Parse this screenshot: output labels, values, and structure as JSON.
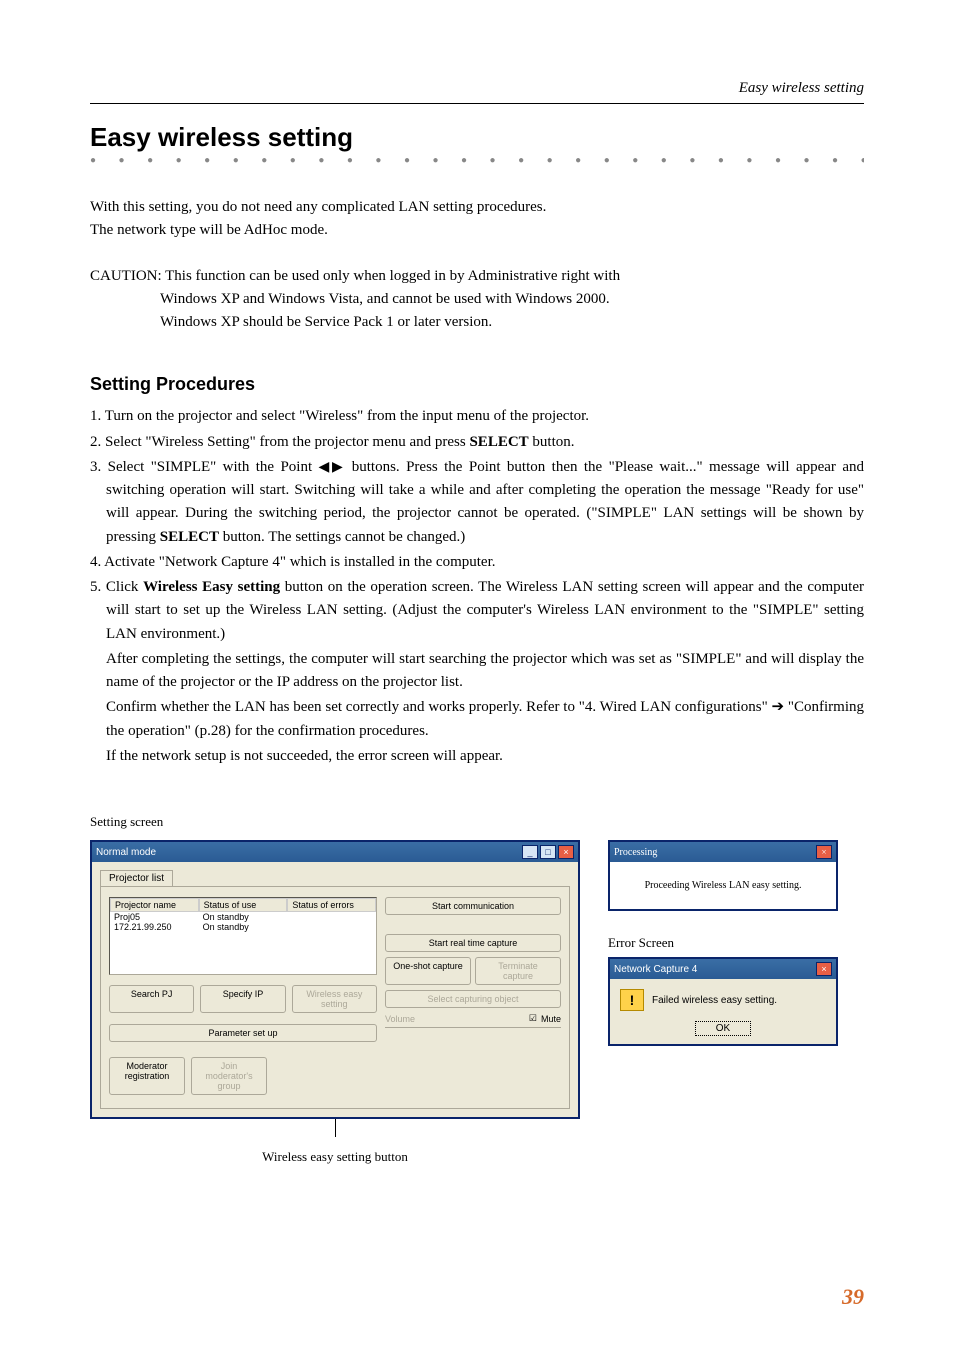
{
  "header": {
    "right_label": "Easy wireless setting"
  },
  "title": "Easy wireless setting",
  "intro": {
    "line1": "With this setting, you do not need any complicated LAN setting procedures.",
    "line2": "The network type will be AdHoc mode."
  },
  "caution": {
    "line1": "CAUTION: This function can be used only when logged in by Administrative right with",
    "line2": "Windows XP and Windows Vista, and cannot be used with Windows 2000.",
    "line3": "Windows XP should be Service Pack 1 or later version."
  },
  "procedures": {
    "heading": "Setting Procedures",
    "s1": "1. Turn on the projector and select \"Wireless\" from the input menu of the projector.",
    "s2_a": "2. Select \"Wireless Setting\" from the projector menu and press ",
    "s2_b": "SELECT",
    "s2_c": " button.",
    "s3_a": "3. Select \"SIMPLE\" with the Point ",
    "s3_b": " buttons. Press the Point button then the \"Please wait...\" message will appear and switching operation will start. Switching will take a while and after completing the operation the message \"Ready for use\" will appear. During the switching period, the projector cannot be operated. (\"SIMPLE\" LAN settings will be shown by pressing ",
    "s3_c": "SELECT",
    "s3_d": " button. The settings cannot be changed.)",
    "s4": "4. Activate \"Network Capture 4\" which is installed in the computer.",
    "s5_a": "5. Click ",
    "s5_b": "Wireless Easy setting",
    "s5_c": " button on the operation screen. The Wireless LAN setting screen will appear and the computer will start to set up the Wireless LAN setting. (Adjust the computer's Wireless LAN environment to the \"SIMPLE\" setting LAN environment.)",
    "p_after": "After completing the settings, the computer will start searching the projector which was set as \"SIMPLE\" and will display the name of the projector or the IP address on the projector list.",
    "p_confirm_a": "Confirm whether the LAN has been set correctly and works properly. Refer to \"4. Wired LAN configurations\" ",
    "p_confirm_b": " \"Confirming the operation\" (p.28) for the confirmation procedures.",
    "p_last": "If the network setup is not succeeded, the error screen will appear."
  },
  "setting_screen_label": "Setting screen",
  "main_window": {
    "title": "Normal mode",
    "tab": "Projector list",
    "cols": {
      "name": "Projector name",
      "use": "Status of use",
      "errors": "Status of errors"
    },
    "rows": [
      {
        "name": "Proj05",
        "use": "On standby",
        "errors": ""
      },
      {
        "name": "172.21.99.250",
        "use": "On standby",
        "errors": ""
      }
    ],
    "buttons": {
      "search": "Search PJ",
      "specify": "Specify IP",
      "wireless": "Wireless easy setting",
      "param": "Parameter set up",
      "mod_reg": "Moderator registration",
      "join": "Join moderator's group"
    },
    "right": {
      "start_comm": "Start communication",
      "start_real": "Start real time capture",
      "one_shot": "One-shot capture",
      "terminate": "Terminate capture",
      "select_obj": "Select capturing object",
      "volume": "Volume",
      "mute": "Mute"
    }
  },
  "caption_button": "Wireless easy setting button",
  "processing": {
    "title": "Processing",
    "body": "Proceeding Wireless LAN easy setting."
  },
  "error_label": "Error Screen",
  "error_window": {
    "title": "Network Capture 4",
    "msg": "Failed wireless easy setting.",
    "ok": "OK"
  },
  "page_number": "39"
}
